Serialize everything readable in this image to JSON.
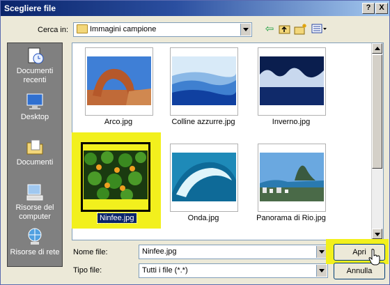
{
  "window": {
    "title": "Scegliere file",
    "help_label": "?",
    "close_label": "X"
  },
  "look_in": {
    "label": "Cerca in:",
    "value": "Immagini campione"
  },
  "toolbar": {
    "icons": [
      "back-arrow-icon",
      "up-folder-icon",
      "new-folder-icon",
      "view-menu-icon"
    ]
  },
  "places": [
    {
      "label": "Documenti recenti",
      "icon": "recent-documents-icon"
    },
    {
      "label": "Desktop",
      "icon": "desktop-icon"
    },
    {
      "label": "Documenti",
      "icon": "documents-folder-icon"
    },
    {
      "label": "Risorse del computer",
      "icon": "my-computer-icon"
    },
    {
      "label": "Risorse di rete",
      "icon": "network-icon"
    }
  ],
  "files": [
    {
      "name": "Arco.jpg",
      "selected": false
    },
    {
      "name": "Colline azzurre.jpg",
      "selected": false
    },
    {
      "name": "Inverno.jpg",
      "selected": false
    },
    {
      "name": "Ninfee.jpg",
      "selected": true
    },
    {
      "name": "Onda.jpg",
      "selected": false
    },
    {
      "name": "Panorama di Rio.jpg",
      "selected": false
    }
  ],
  "filename": {
    "label": "Nome file:",
    "value": "Ninfee.jpg"
  },
  "filetype": {
    "label": "Tipo file:",
    "value": "Tutti i file (*.*)"
  },
  "buttons": {
    "open": "Apri",
    "cancel": "Annulla"
  },
  "colors": {
    "highlight": "#f2f01d",
    "title_blue": "#0a246a",
    "places_bg": "#808080"
  }
}
